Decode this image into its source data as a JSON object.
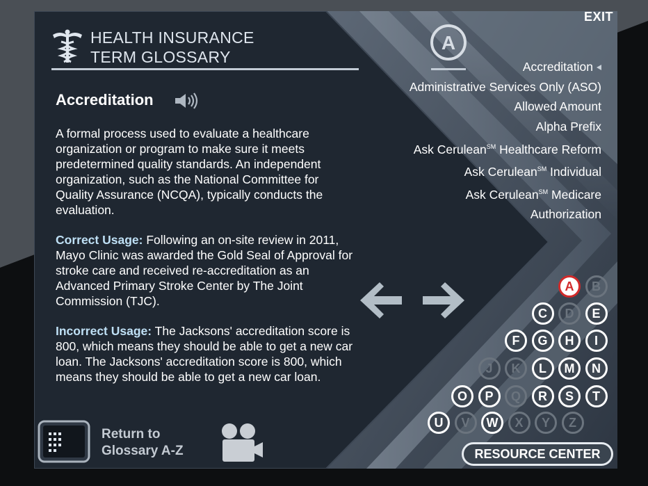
{
  "window": {
    "exit_label": "EXIT"
  },
  "glossary": {
    "title_line1": "HEALTH INSURANCE",
    "title_line2": "TERM GLOSSARY"
  },
  "term": {
    "name": "Accreditation",
    "definition": "A formal process used to evaluate a healthcare organization or program to make sure it meets predetermined quality standards. An independent organization, such as the National Committee for Quality Assurance (NCQA), typically conducts the evaluation.",
    "correct_label": "Correct Usage:",
    "correct_text": "Following an on-site review in 2011, Mayo Clinic was awarded the Gold Seal of Approval for stroke care and received re-accreditation as an Advanced Primary Stroke Center by The Joint Commission (TJC).",
    "incorrect_label": "Incorrect Usage:",
    "incorrect_text": "The Jacksons' accreditation score is 800, which means they should be able to get a new car loan. The Jacksons' accreditation score is 800, which means they should be able to get a new car loan."
  },
  "current_letter": "A",
  "term_list": [
    {
      "text": "Accreditation",
      "sup": "",
      "rest": "",
      "active": true
    },
    {
      "text": "Administrative Services Only (ASO)",
      "sup": "",
      "rest": "",
      "active": false
    },
    {
      "text": "Allowed Amount",
      "sup": "",
      "rest": "",
      "active": false
    },
    {
      "text": "Alpha Prefix",
      "sup": "",
      "rest": "",
      "active": false
    },
    {
      "text": "Ask Cerulean",
      "sup": "SM",
      "rest": " Healthcare Reform",
      "active": false
    },
    {
      "text": "Ask Cerulean",
      "sup": "SM",
      "rest": " Individual",
      "active": false
    },
    {
      "text": "Ask Cerulean",
      "sup": "SM",
      "rest": " Medicare",
      "active": false
    },
    {
      "text": "Authorization",
      "sup": "",
      "rest": "",
      "active": false
    }
  ],
  "letters": [
    {
      "l": "A",
      "s": "sel"
    },
    {
      "l": "B",
      "s": "dim"
    },
    {
      "l": "C",
      "s": "en"
    },
    {
      "l": "D",
      "s": "dim"
    },
    {
      "l": "E",
      "s": "en"
    },
    {
      "l": "F",
      "s": "en"
    },
    {
      "l": "G",
      "s": "en"
    },
    {
      "l": "H",
      "s": "en"
    },
    {
      "l": "I",
      "s": "en"
    },
    {
      "l": "J",
      "s": "dim"
    },
    {
      "l": "K",
      "s": "dim"
    },
    {
      "l": "L",
      "s": "en"
    },
    {
      "l": "M",
      "s": "en"
    },
    {
      "l": "N",
      "s": "en"
    },
    {
      "l": "O",
      "s": "en"
    },
    {
      "l": "P",
      "s": "en"
    },
    {
      "l": "Q",
      "s": "dim"
    },
    {
      "l": "R",
      "s": "en"
    },
    {
      "l": "S",
      "s": "en"
    },
    {
      "l": "T",
      "s": "en"
    },
    {
      "l": "U",
      "s": "en"
    },
    {
      "l": "V",
      "s": "dim"
    },
    {
      "l": "W",
      "s": "en"
    },
    {
      "l": "X",
      "s": "dim"
    },
    {
      "l": "Y",
      "s": "dim"
    },
    {
      "l": "Z",
      "s": "dim"
    }
  ],
  "footer": {
    "return_line1": "Return to",
    "return_line2": "Glossary A-Z",
    "resource_center": "RESOURCE CENTER"
  },
  "colors": {
    "selected_letter": "#d12a2a",
    "background": "#2a3340",
    "usage_label": "#bfe0f5"
  }
}
